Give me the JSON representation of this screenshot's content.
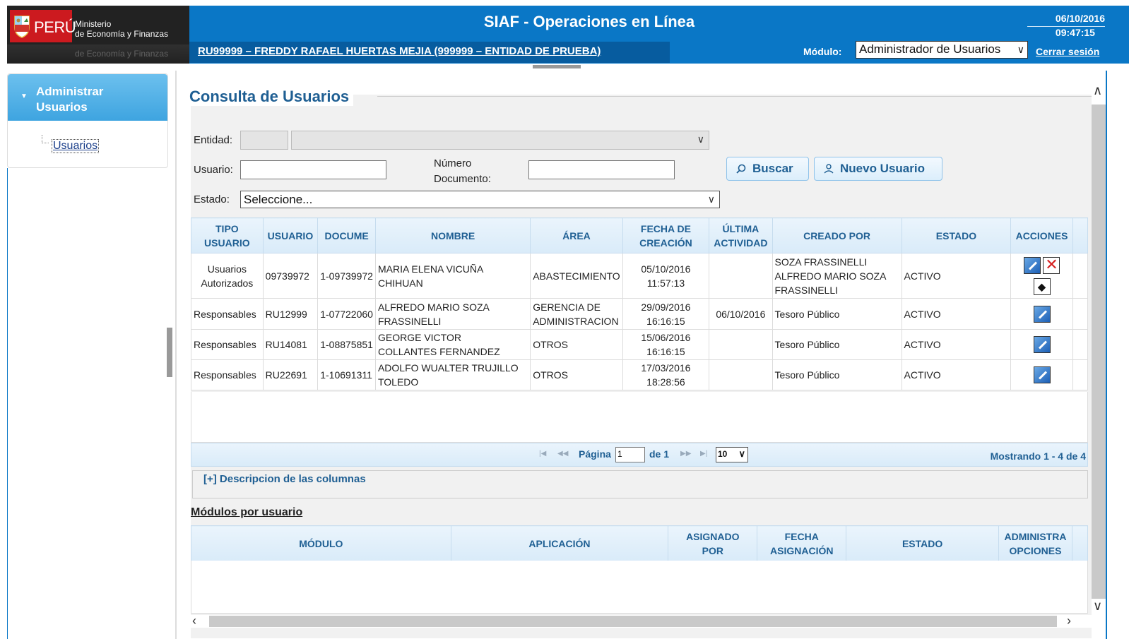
{
  "header": {
    "country": "PERÚ",
    "ministry_line1": "Ministerio",
    "ministry_line2": "de Economía y Finanzas",
    "ministry_reflect": "de Economía y Finanzas",
    "app_title": "SIAF - Operaciones en Línea",
    "date": "06/10/2016",
    "time": "09:47:15",
    "user_link": "RU99999  – FREDDY RAFAEL HUERTAS MEJIA (999999  – ENTIDAD DE PRUEBA)",
    "module_label": "Módulo:",
    "module_value": "Administrador de Usuarios",
    "logout": "Cerrar sesión"
  },
  "sidebar": {
    "section_title_line1": "Administrar",
    "section_title_line2": "Usuarios",
    "item": "Usuarios"
  },
  "form": {
    "title": "Consulta de Usuarios",
    "entidad_label": "Entidad:",
    "usuario_label": "Usuario:",
    "numdoc_label_line1": "Número",
    "numdoc_label_line2": "Documento:",
    "estado_label": "Estado:",
    "estado_value": "Seleccione...",
    "buscar": "Buscar",
    "nuevo_usuario": "Nuevo Usuario"
  },
  "grid": {
    "columns": [
      [
        "TIPO",
        "USUARIO"
      ],
      [
        "USUARIO"
      ],
      [
        "DOCUME"
      ],
      [
        "NOMBRE"
      ],
      [
        "ÁREA"
      ],
      [
        "FECHA DE",
        "CREACIÓN"
      ],
      [
        "ÚLTIMA",
        "ACTIVIDAD"
      ],
      [
        "CREADO POR"
      ],
      [
        "ESTADO"
      ],
      [
        "ACCIONES"
      ]
    ],
    "rows": [
      {
        "tipo1": "Usuarios",
        "tipo2": "Autorizados",
        "usuario": "09739972",
        "doc": "1-09739972",
        "nombre1": "MARIA ELENA VICUÑA",
        "nombre2": "CHIHUAN",
        "area1": "ABASTECIMIENTO",
        "area2": "",
        "fecha1": "05/10/2016",
        "fecha2": "11:57:13",
        "ultima": "",
        "creado1": "SOZA FRASSINELLI",
        "creado2": "ALFREDO MARIO SOZA",
        "creado3": "FRASSINELLI",
        "estado": "ACTIVO"
      },
      {
        "tipo1": "Responsables",
        "tipo2": "",
        "usuario": "RU12999",
        "doc": "1-07722060",
        "nombre1": "ALFREDO MARIO SOZA",
        "nombre2": "FRASSINELLI",
        "area1": "GERENCIA DE",
        "area2": "ADMINISTRACION",
        "fecha1": "29/09/2016",
        "fecha2": "16:16:15",
        "ultima": "06/10/2016",
        "creado1": "Tesoro Público",
        "creado2": "",
        "creado3": "",
        "estado": "ACTIVO"
      },
      {
        "tipo1": "Responsables",
        "tipo2": "",
        "usuario": "RU14081",
        "doc": "1-08875851",
        "nombre1": "GEORGE VICTOR",
        "nombre2": "COLLANTES FERNANDEZ",
        "area1": "OTROS",
        "area2": "",
        "fecha1": "15/06/2016",
        "fecha2": "16:16:15",
        "ultima": "",
        "creado1": "Tesoro Público",
        "creado2": "",
        "creado3": "",
        "estado": "ACTIVO"
      },
      {
        "tipo1": "Responsables",
        "tipo2": "",
        "usuario": "RU22691",
        "doc": "1-10691311",
        "nombre1": "ADOLFO WUALTER TRUJILLO",
        "nombre2": "TOLEDO",
        "area1": "OTROS",
        "area2": "",
        "fecha1": "17/03/2016",
        "fecha2": "18:28:56",
        "ultima": "",
        "creado1": "Tesoro Público",
        "creado2": "",
        "creado3": "",
        "estado": "ACTIVO"
      }
    ]
  },
  "pager": {
    "first": "|◀",
    "prev": "◀◀",
    "page_label": "Página",
    "page_value": "1",
    "of_label": "de 1",
    "next": "▶▶",
    "last": "▶|",
    "page_size": "10",
    "showing": "Mostrando 1 - 4 de 4"
  },
  "desc_columns": "[+] Descripcion de las columnas",
  "modules": {
    "title": "Módulos por usuario",
    "columns": [
      [
        "MÓDULO"
      ],
      [
        "APLICACIÓN"
      ],
      [
        "ASIGNADO",
        "POR"
      ],
      [
        "FECHA",
        "ASIGNACIÓN"
      ],
      [
        "ESTADO"
      ],
      [
        "ADMINISTRA",
        "OPCIONES"
      ]
    ]
  },
  "icons": {
    "buscar": "search-icon",
    "nuevo": "user-icon",
    "edit": "edit-icon",
    "delete": "delete-icon",
    "tag": "tag-icon"
  },
  "colors": {
    "header_blue": "#0a77c6",
    "title_blue": "#1f5f93",
    "peru_red": "#cc1a1f"
  }
}
